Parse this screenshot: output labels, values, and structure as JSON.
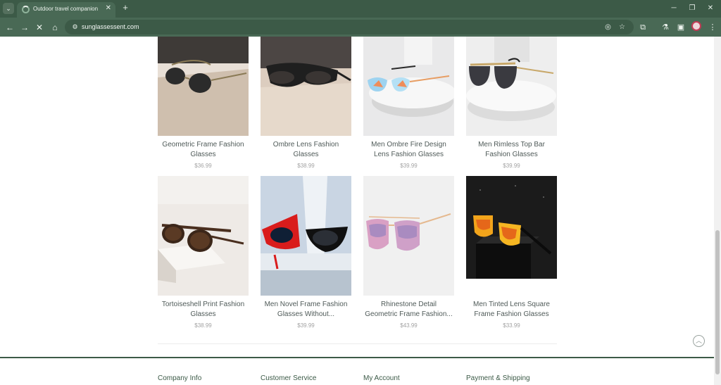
{
  "browser": {
    "tab_title": "Outdoor travel companion",
    "url": "sunglassessent.com",
    "colors": {
      "frame": "#3c5a47",
      "toolbar": "#496955"
    }
  },
  "products": [
    {
      "name": "Geometric Frame Fashion Glasses",
      "price": "$36.99"
    },
    {
      "name": "Ombre Lens Fashion Glasses",
      "price": "$38.99"
    },
    {
      "name": "Men Ombre Fire Design Lens Fashion Glasses",
      "price": "$39.99"
    },
    {
      "name": "Men Rimless Top Bar Fashion Glasses",
      "price": "$39.99"
    },
    {
      "name": "Tortoiseshell Print Fashion Glasses",
      "price": "$38.99"
    },
    {
      "name": "Men Novel Frame Fashion Glasses Without...",
      "price": "$39.99"
    },
    {
      "name": "Rhinestone Detail Geometric Frame Fashion...",
      "price": "$43.99"
    },
    {
      "name": "Men Tinted Lens Square Frame Fashion Glasses",
      "price": "$33.99"
    }
  ],
  "footer": {
    "columns": [
      "Company Info",
      "Customer Service",
      "My Account",
      "Payment & Shipping"
    ]
  }
}
